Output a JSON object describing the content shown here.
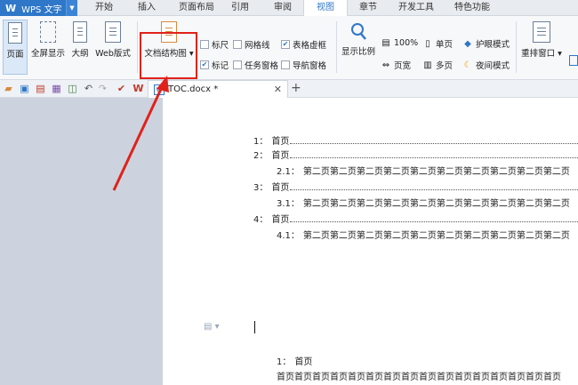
{
  "app": {
    "logo": "W",
    "name": "WPS 文字"
  },
  "tabs": [
    "开始",
    "插入",
    "页面布局",
    "引用",
    "审阅",
    "视图",
    "章节",
    "开发工具",
    "特色功能"
  ],
  "active_tab": "视图",
  "ribbon": {
    "page_view": "页面",
    "full_screen": "全屏显示",
    "outline": "大纲",
    "web_view": "Web版式",
    "doc_map": "文档结构图",
    "ruler": "标尺",
    "gridlines": "网格线",
    "table_gridlines": "表格虚框",
    "markup": "标记",
    "task_pane": "任务窗格",
    "nav_pane": "导航窗格",
    "zoom": "显示比例",
    "zoom_100": "100%",
    "single_page": "单页",
    "page_width": "页宽",
    "multi_page": "多页",
    "eye_mode": "护眼模式",
    "night_mode": "夜间模式",
    "arrange_window": "重排窗口"
  },
  "doc_tab": {
    "icon": "W",
    "name": "TOC.docx *"
  },
  "toc": [
    {
      "num": "1：",
      "text": "首页"
    },
    {
      "num": "2：",
      "text": "首页"
    },
    {
      "num": "2.1：",
      "text": "第二页第二页第二页第二页第二页第二页第二页第二页第二页第二页"
    },
    {
      "num": "3：",
      "text": "首页"
    },
    {
      "num": "3.1：",
      "text": "第二页第二页第二页第二页第二页第二页第二页第二页第二页第二页"
    },
    {
      "num": "4：",
      "text": "首页"
    },
    {
      "num": "4.1：",
      "text": "第二页第二页第二页第二页第二页第二页第二页第二页第二页第二页"
    }
  ],
  "body": {
    "heading_num": "1：",
    "heading": "首页",
    "para": "首页首页首页首页首页首页首页首页首页首页首页首页首页首页首页首页"
  },
  "colors": {
    "accent": "#2f77c8",
    "highlight": "#e0221b"
  }
}
